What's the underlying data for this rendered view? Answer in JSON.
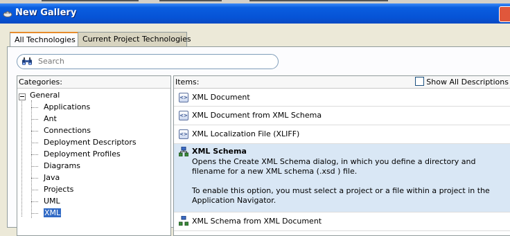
{
  "window": {
    "title": "New Gallery"
  },
  "tabs": [
    {
      "label": "All Technologies",
      "active": true
    },
    {
      "label": "Current Project Technologies",
      "active": false
    }
  ],
  "search": {
    "placeholder": "Search",
    "value": ""
  },
  "categories": {
    "header": "Categories:",
    "root": {
      "label": "General",
      "expanded": true
    },
    "children": [
      {
        "label": "Applications"
      },
      {
        "label": "Ant"
      },
      {
        "label": "Connections"
      },
      {
        "label": "Deployment Descriptors"
      },
      {
        "label": "Deployment Profiles"
      },
      {
        "label": "Diagrams"
      },
      {
        "label": "Java"
      },
      {
        "label": "Projects"
      },
      {
        "label": "UML"
      },
      {
        "label": "XML",
        "selected": true
      }
    ]
  },
  "items": {
    "header": "Items:",
    "show_all_descriptions": {
      "label": "Show All Descriptions",
      "checked": false
    },
    "list": [
      {
        "label": "XML Document",
        "icon": "xml-document-icon"
      },
      {
        "label": "XML Document from XML Schema",
        "icon": "xml-document-icon"
      },
      {
        "label": "XML Localization File (XLIFF)",
        "icon": "xml-document-icon"
      },
      {
        "label": "XML Schema",
        "icon": "xml-schema-icon",
        "selected": true,
        "desc1": "Opens the Create XML Schema dialog, in which you define a directory and filename for a new XML schema (.xsd ) file.",
        "desc2": "To enable this option, you must select a project or a file within a project in the Application Navigator."
      },
      {
        "label": "XML Schema from XML Document",
        "icon": "xml-schema-icon"
      }
    ]
  },
  "colors": {
    "title_bar": "#0653d6",
    "selection": "#316ac5",
    "selected_item_bg": "#d9e7f5",
    "active_tab_accent": "#e68b2c"
  }
}
